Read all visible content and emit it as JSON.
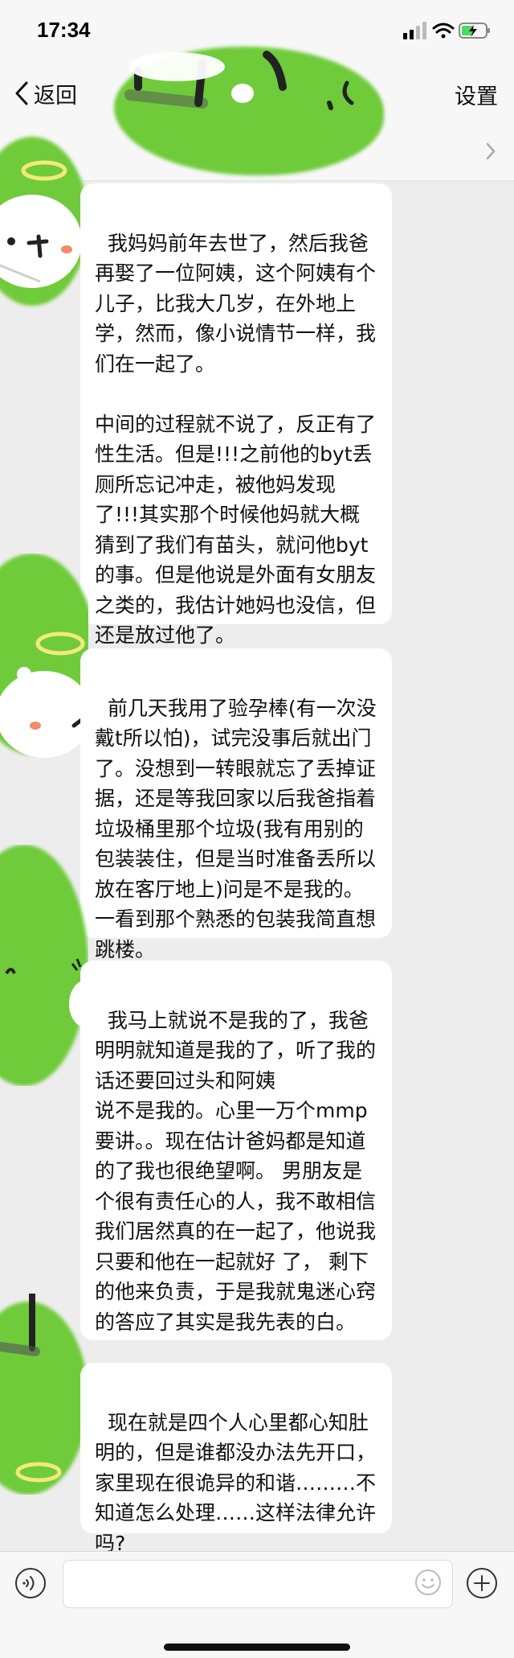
{
  "status": {
    "time": "17:34"
  },
  "nav": {
    "back_label": "返回",
    "settings_label": "设置"
  },
  "messages": [
    {
      "text": "我妈妈前年去世了，然后我爸再娶了一位阿姨，这个阿姨有个儿子，比我大几岁，在外地上学，然而，像小说情节一样，我们在一起了。\n\n中间的过程就不说了，反正有了性生活。但是!!!之前他的byt丢厕所忘记冲走，被他妈发现了!!!其实那个时候他妈就大概猜到了我们有苗头，就问他byt的事。但是他说是外面有女朋友之类的，我估计她妈也没信，但还是放过他了。"
    },
    {
      "text": "前几天我用了验孕棒(有一次没戴t所以怕)，试完没事后就出门了。没想到一转眼就忘了丢掉证据，还是等我回家以后我爸指着垃圾桶里那个垃圾(我有用别的包装装住，但是当时准备丢所以放在客厅地上)问是不是我的。一看到那个熟悉的包装我简直想跳楼。"
    },
    {
      "text": "我马上就说不是我的了，我爸明明就知道是我的了，听了我的话还要回过头和阿姨\n说不是我的。心里一万个mmp要讲。。现在估计爸妈都是知道的了我也很绝望啊。 男朋友是个很有责任心的人，我不敢相信我们居然真的在一起了，他说我只要和他在一起就好 了， 剩下的他来负责，于是我就鬼迷心窍的答应了其实是我先表的白。"
    },
    {
      "text": "现在就是四个人心里都心知肚明的，但是谁都没办法先开口，家里现在很诡异的和谐………不知道怎么处理……这样法律允许吗?"
    }
  ],
  "colors": {
    "avatar_green": "#6fcb3a",
    "bubble_bg": "#ffffff",
    "chat_bg": "#ededed"
  }
}
